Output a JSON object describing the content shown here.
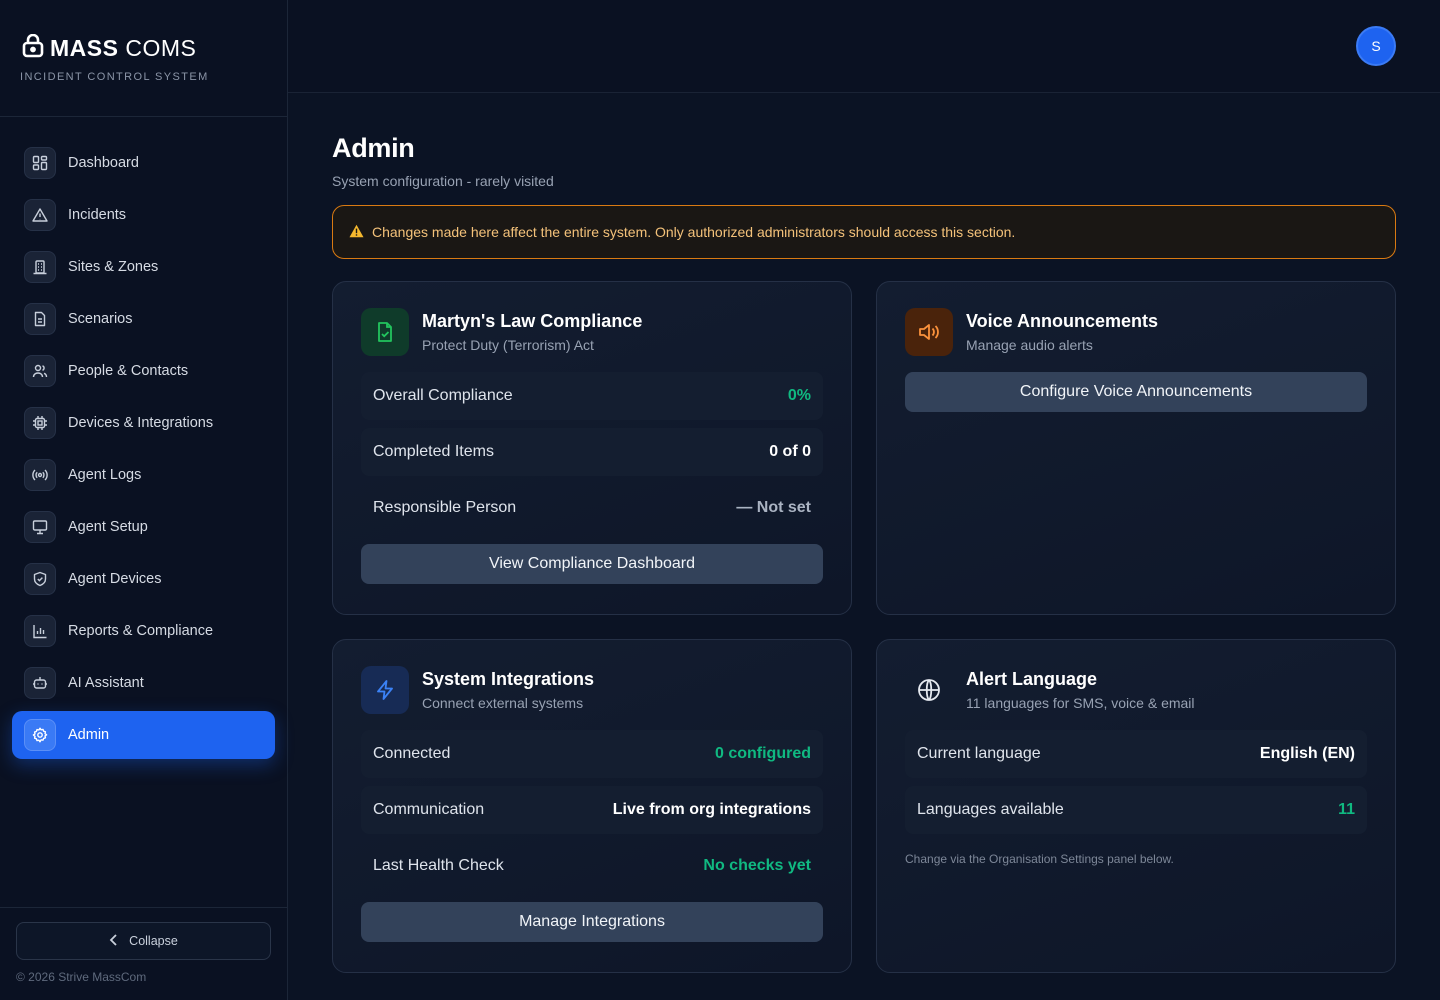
{
  "brand": {
    "name_bold": "MASS",
    "name_light": "COMS",
    "subtitle": "INCIDENT CONTROL SYSTEM"
  },
  "sidebar": {
    "items": [
      {
        "label": "Dashboard",
        "icon": "dashboard-grid-icon"
      },
      {
        "label": "Incidents",
        "icon": "warning-triangle-icon"
      },
      {
        "label": "Sites & Zones",
        "icon": "building-icon"
      },
      {
        "label": "Scenarios",
        "icon": "document-icon"
      },
      {
        "label": "People & Contacts",
        "icon": "people-icon"
      },
      {
        "label": "Devices & Integrations",
        "icon": "chip-icon"
      },
      {
        "label": "Agent Logs",
        "icon": "broadcast-icon"
      },
      {
        "label": "Agent Setup",
        "icon": "monitor-icon"
      },
      {
        "label": "Agent Devices",
        "icon": "shield-icon"
      },
      {
        "label": "Reports & Compliance",
        "icon": "bar-chart-icon"
      },
      {
        "label": "AI Assistant",
        "icon": "bot-icon"
      },
      {
        "label": "Admin",
        "icon": "gear-icon",
        "active": true
      }
    ],
    "collapse_label": "Collapse",
    "copyright": "© 2026 Strive MassCom"
  },
  "header": {
    "avatar_initial": "S"
  },
  "page": {
    "title": "Admin",
    "subtitle": "System configuration - rarely visited",
    "alert": "Changes made here affect the entire system. Only authorized administrators should access this section."
  },
  "cards": {
    "compliance": {
      "title": "Martyn's Law Compliance",
      "subtitle": "Protect Duty (Terrorism) Act",
      "rows": [
        {
          "label": "Overall Compliance",
          "value": "0%"
        },
        {
          "label": "Completed Items",
          "value": "0 of 0"
        },
        {
          "label": "Responsible Person",
          "value": "— Not set"
        }
      ],
      "button": "View Compliance Dashboard"
    },
    "voice": {
      "title": "Voice Announcements",
      "subtitle": "Manage audio alerts",
      "button": "Configure Voice Announcements"
    },
    "integrations": {
      "title": "System Integrations",
      "subtitle": "Connect external systems",
      "rows": [
        {
          "label": "Connected",
          "value": "0 configured"
        },
        {
          "label": "Communication",
          "value": "Live from org integrations"
        },
        {
          "label": "Last Health Check",
          "value": "No checks yet"
        }
      ],
      "button": "Manage Integrations"
    },
    "language": {
      "title": "Alert Language",
      "subtitle": "11 languages for SMS, voice & email",
      "rows": [
        {
          "label": "Current language",
          "value": "English (EN)"
        },
        {
          "label": "Languages available",
          "value": "11"
        }
      ],
      "note": "Change via the Organisation Settings panel below."
    }
  },
  "colors": {
    "accent": "#1e63f0",
    "warning": "#d97a12",
    "success": "#10b981"
  }
}
